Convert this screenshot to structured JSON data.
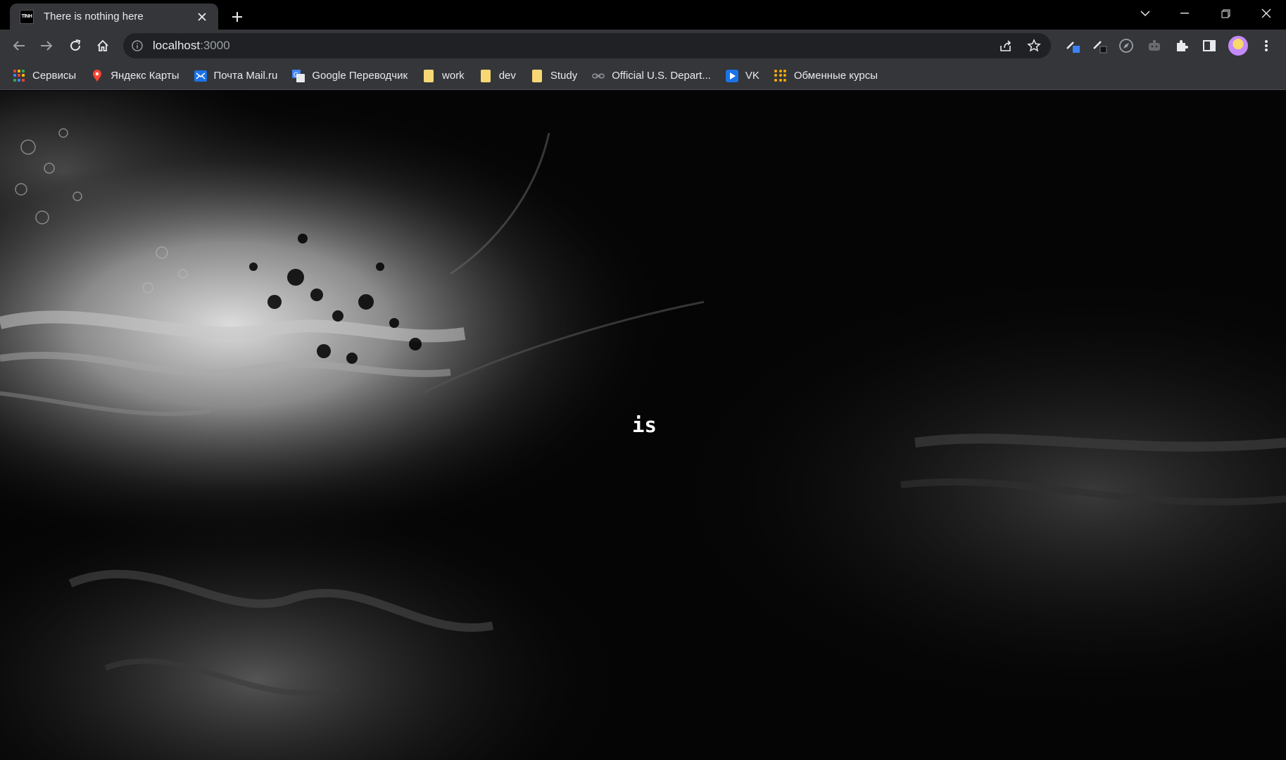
{
  "browser": {
    "tab": {
      "favicon_text": "TINH",
      "title": "There is nothing here"
    },
    "omnibox": {
      "url_host": "localhost",
      "url_port": ":3000"
    },
    "icons": {
      "back": "arrow-left-icon",
      "forward": "arrow-right-icon",
      "reload": "reload-icon",
      "home": "home-icon",
      "site_info": "info-icon",
      "share": "share-icon",
      "bookmark": "star-icon",
      "extensions": "puzzle-icon",
      "side_panel": "side-panel-icon",
      "menu": "kebab-menu-icon"
    }
  },
  "bookmarks": [
    {
      "label": "Сервисы",
      "icon": "apps-grid-icon"
    },
    {
      "label": "Яндекс Карты",
      "icon": "map-pin-icon"
    },
    {
      "label": "Почта Mail.ru",
      "icon": "mail-icon"
    },
    {
      "label": "Google Переводчик",
      "icon": "translate-icon"
    },
    {
      "label": "work",
      "icon": "folder-icon"
    },
    {
      "label": "dev",
      "icon": "folder-icon"
    },
    {
      "label": "Study",
      "icon": "folder-icon"
    },
    {
      "label": "Official U.S. Depart...",
      "icon": "link-icon"
    },
    {
      "label": "VK",
      "icon": "play-icon"
    },
    {
      "label": "Обменные курсы",
      "icon": "grid-dots-icon"
    }
  ],
  "page": {
    "center_word": "is"
  },
  "colors": {
    "chrome_dark": "#35363a",
    "omnibox_bg": "#202124",
    "page_bg": "#050505",
    "folder": "#f8d775"
  }
}
